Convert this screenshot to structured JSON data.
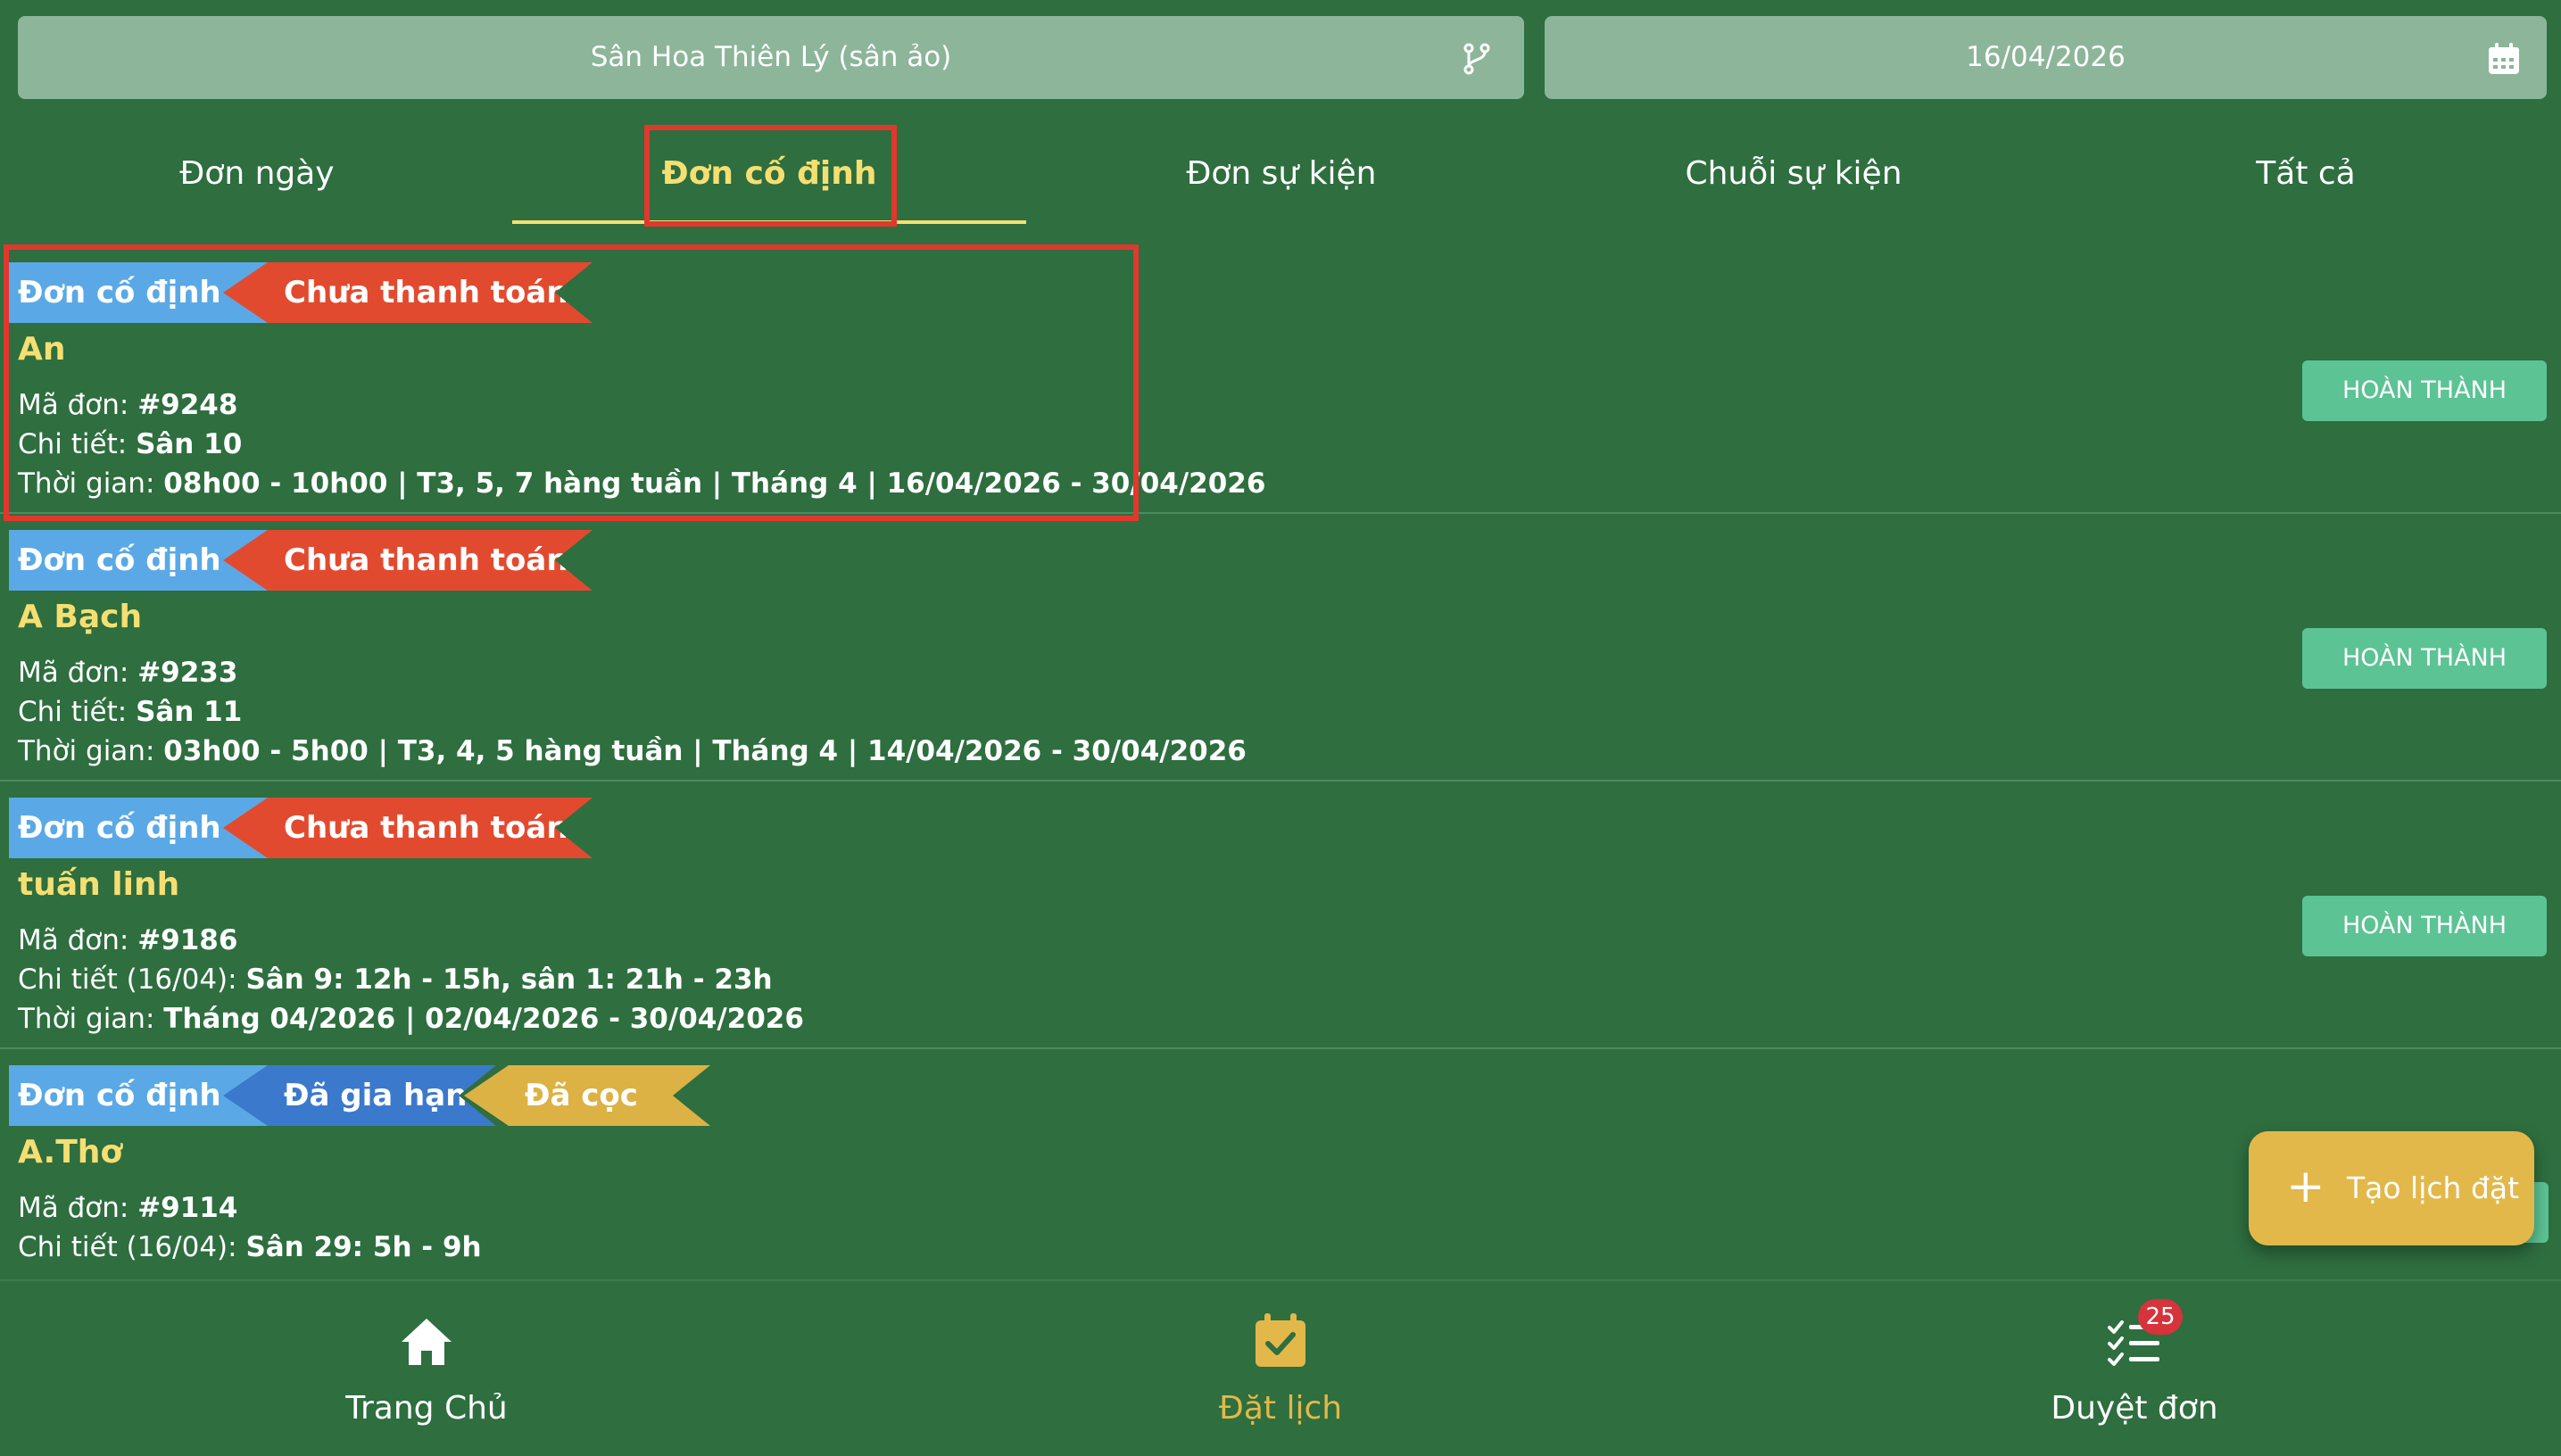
{
  "top_bar": {
    "field_selector": "Sân Hoa Thiên Lý (sân ảo)",
    "date_selector": "16/04/2026"
  },
  "tabs": [
    {
      "label": "Đơn ngày"
    },
    {
      "label": "Đơn cố định"
    },
    {
      "label": "Đơn sự kiện"
    },
    {
      "label": "Chuỗi sự kiện"
    },
    {
      "label": "Tất cả"
    }
  ],
  "active_tab": "Đơn cố định",
  "orders": [
    {
      "tags": [
        "Đơn cố định",
        "Chưa thanh toán"
      ],
      "name": "An",
      "code_label": "Mã đơn: ",
      "code": "#9248",
      "detail_label": "Chi tiết: ",
      "detail": "Sân 10",
      "time_label": "Thời gian: ",
      "time": "08h00 - 10h00 | T3, 5, 7 hàng tuần | Tháng 4 | 16/04/2026 - 30/04/2026",
      "action": "HOÀN THÀNH"
    },
    {
      "tags": [
        "Đơn cố định",
        "Chưa thanh toán"
      ],
      "name": "A Bạch",
      "code_label": "Mã đơn: ",
      "code": "#9233",
      "detail_label": "Chi tiết: ",
      "detail": "Sân 11",
      "time_label": "Thời gian: ",
      "time": "03h00 - 5h00 | T3, 4, 5 hàng tuần | Tháng 4 | 14/04/2026 - 30/04/2026",
      "action": "HOÀN THÀNH"
    },
    {
      "tags": [
        "Đơn cố định",
        "Chưa thanh toán"
      ],
      "name": "tuấn linh",
      "code_label": "Mã đơn: ",
      "code": "#9186",
      "detail_label": "Chi tiết (16/04): ",
      "detail": "Sân 9: 12h - 15h, sân 1: 21h - 23h",
      "time_label": "Thời gian: ",
      "time": "Tháng 04/2026 | 02/04/2026 - 30/04/2026",
      "action": "HOÀN THÀNH"
    },
    {
      "tags": [
        "Đơn cố định",
        "Đã gia hạn",
        "Đã cọc"
      ],
      "name": "A.Thơ",
      "code_label": "Mã đơn: ",
      "code": "#9114",
      "detail_label": "Chi tiết (16/04): ",
      "detail": "Sân 29: 5h - 9h"
    }
  ],
  "fab": {
    "label": "Tạo lịch đặt",
    "icon": "plus-icon"
  },
  "bottom_nav": [
    {
      "label": "Trang Chủ",
      "icon": "home-icon"
    },
    {
      "label": "Đặt lịch",
      "icon": "calendar-check-icon"
    },
    {
      "label": "Duyệt đơn",
      "icon": "checklist-icon",
      "badge": "25"
    }
  ],
  "colors": {
    "background": "#2e6e3f",
    "accent_yellow": "#f5df72",
    "tag_fixed": "#5aa9e6",
    "tag_unpaid": "#e24a2f",
    "tag_renewed": "#3b79cc",
    "tag_deposit": "#dcb245",
    "complete_button": "#5cc394",
    "highlight_box": "#e2372d"
  }
}
